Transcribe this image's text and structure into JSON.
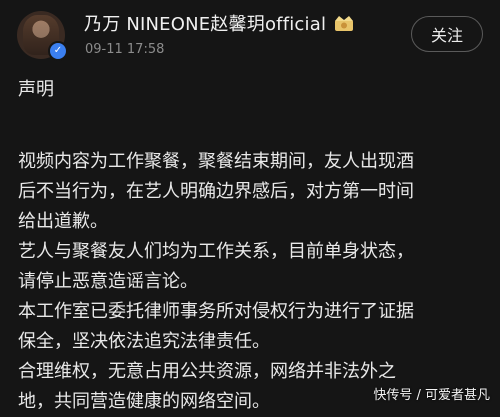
{
  "post": {
    "author": "乃万 NINEONE赵馨玥official",
    "timestamp": "09-11 17:58",
    "follow_label": "关注",
    "title": "声明",
    "paragraphs": [
      [
        "视频内容为工作聚餐，聚餐结束期间，友人出现酒",
        "后不当行为，在艺人明确边界感后，对方第一时间",
        "给出道歉。"
      ],
      [
        "艺人与聚餐友人们均为工作关系，目前单身状态，",
        "请停止恶意造谣言论。"
      ],
      [
        "本工作室已委托律师事务所对侵权行为进行了证据",
        "保全，坚决依法追究法律责任。"
      ],
      [
        "合理维权，无意占用公共资源，网络并非法外之",
        "地，共同营造健康的网络空间。"
      ]
    ]
  },
  "watermark": "快传号 / 可爱者甚凡",
  "colors": {
    "background": "#151515",
    "text": "#e8e8e8",
    "meta": "#8c8c8c",
    "verified": "#3b7ff0"
  },
  "icons": {
    "verified": "verified-badge-icon",
    "crown": "crown-badge-icon"
  }
}
